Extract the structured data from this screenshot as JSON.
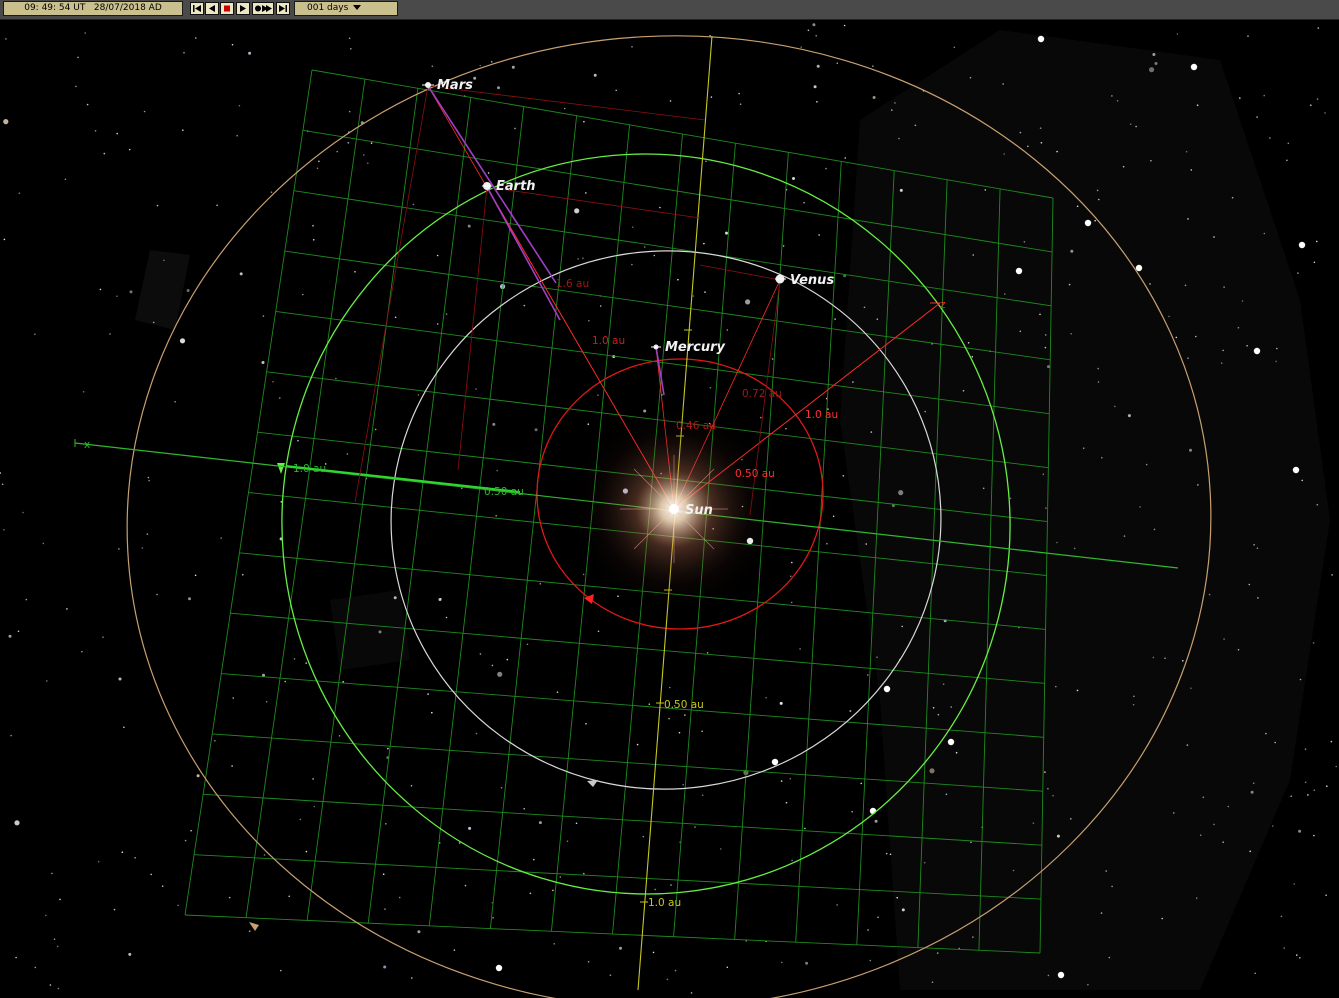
{
  "toolbar": {
    "time": "09: 49: 54 UT",
    "date": "28/07/2018 AD",
    "step": "001 days",
    "buttons": [
      "skip-back-icon",
      "step-back-icon",
      "stop-icon",
      "play-icon",
      "fast-forward-icon",
      "skip-forward-icon",
      "chevron-down-icon"
    ]
  },
  "planets": {
    "mars": "Mars",
    "earth": "Earth",
    "venus": "Venus",
    "mercury": "Mercury",
    "sun": "Sun"
  },
  "axes": {
    "x": "x",
    "z": "z"
  },
  "scale_labels": {
    "red_mars_1": "1.0 au",
    "red_earth_1": "1.0 au",
    "red_z_1": "1.0 au",
    "red_z_050": "0.50 au",
    "red_venus_072": "0.72 au",
    "red_mercury_046": "0.46 au",
    "red_earth_16": "1.6 au",
    "green_x_1": "1.0 au",
    "green_x_050": "0.50 au",
    "yellow_050": "0.50 au",
    "yellow_1": "1.0 au"
  },
  "colors": {
    "grid": "#1e8a1e",
    "orbit_mars": "#c8a070",
    "orbit_earth": "#66ee44",
    "orbit_venus": "#d8d8d8",
    "orbit_mercury": "#e01818",
    "red_axis": "#ff2a2a",
    "yellow_axis": "#c8c820",
    "toolbar_field": "#c9c08e"
  }
}
